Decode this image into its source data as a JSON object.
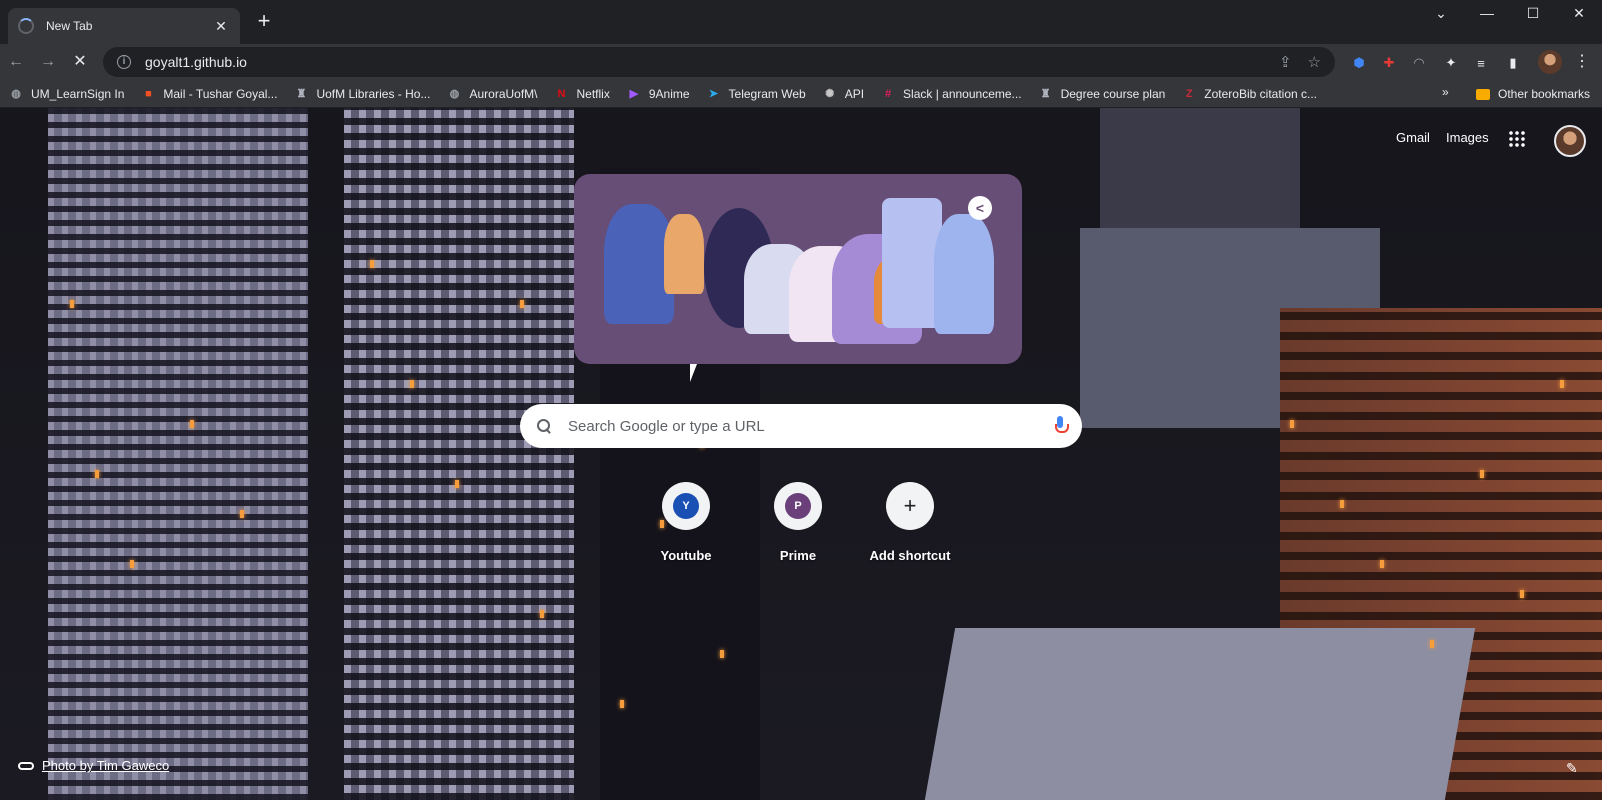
{
  "window": {
    "tab_title": "New Tab",
    "tab_close": "✕",
    "new_tab": "+",
    "controls": {
      "tabsearch": "⌄",
      "minimize": "—",
      "maximize": "☐",
      "close": "✕"
    }
  },
  "toolbar": {
    "back": "←",
    "forward": "→",
    "stop": "✕",
    "url": "goyalt1.github.io",
    "info": "i",
    "share_icon": "⇪",
    "star_icon": "☆",
    "menu": "⋮"
  },
  "bookmarks": {
    "items": [
      {
        "label": "UM_LearnSign In",
        "icon": "globe-icon",
        "color": "#9aa0a6",
        "glyph": "◍"
      },
      {
        "label": "Mail - Tushar Goyal...",
        "icon": "microsoft-icon",
        "color": "#f25022",
        "glyph": "■"
      },
      {
        "label": "UofM Libraries - Ho...",
        "icon": "umanitoba-icon",
        "color": "#b0b4bf",
        "glyph": "♜"
      },
      {
        "label": "AuroraUofM\\",
        "icon": "globe-icon",
        "color": "#9aa0a6",
        "glyph": "◍"
      },
      {
        "label": "Netflix",
        "icon": "netflix-icon",
        "color": "#e50914",
        "glyph": "N"
      },
      {
        "label": "9Anime",
        "icon": "play-icon",
        "color": "#a259ff",
        "glyph": "▶"
      },
      {
        "label": "Telegram Web",
        "icon": "telegram-icon",
        "color": "#2aabee",
        "glyph": "➤"
      },
      {
        "label": "API",
        "icon": "openai-icon",
        "color": "#c8c8c8",
        "glyph": "✺"
      },
      {
        "label": "Slack | announceme...",
        "icon": "slack-icon",
        "color": "#e01e5a",
        "glyph": "#"
      },
      {
        "label": "Degree course plan",
        "icon": "umanitoba-icon",
        "color": "#b0b4bf",
        "glyph": "♜"
      },
      {
        "label": "ZoteroBib citation c...",
        "icon": "zotero-icon",
        "color": "#cc2936",
        "glyph": "Z"
      }
    ],
    "overflow": "»",
    "other": "Other bookmarks"
  },
  "ntp": {
    "gmail": "Gmail",
    "images": "Images",
    "doodle_share": "<",
    "search_placeholder": "Search Google or type a URL",
    "shortcuts": [
      {
        "label": "Youtube",
        "letter": "Y",
        "color": "#1a4fb3"
      },
      {
        "label": "Prime",
        "letter": "P",
        "color": "#6a3f7a"
      },
      {
        "label": "Add shortcut",
        "letter": "+",
        "color": "#f1f3f4"
      }
    ],
    "attribution": "Photo by Tim Gaweco",
    "edit_icon": "✎"
  }
}
